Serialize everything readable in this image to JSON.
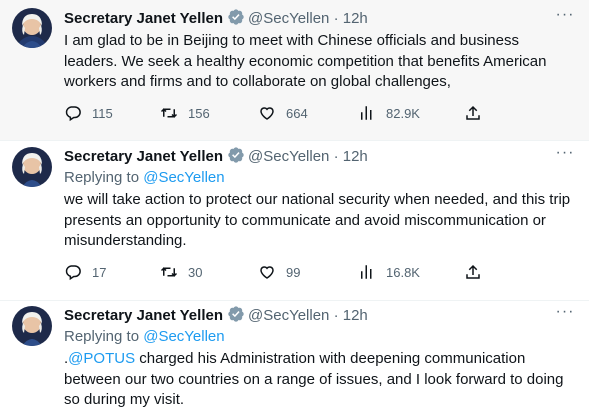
{
  "author": {
    "name": "Secretary Janet Yellen",
    "handle": "@SecYellen",
    "time": "12h",
    "separator": "·",
    "verified_color": "#829aab"
  },
  "colors": {
    "link": "#1d9bf0",
    "muted": "#536471",
    "text": "#0f1419"
  },
  "tweets": [
    {
      "text": "I am glad to be in Beijing to meet with Chinese officials and business leaders. We seek a healthy economic competition that benefits American workers and firms and to collaborate on global challenges,",
      "replies": "115",
      "retweets": "156",
      "likes": "664",
      "views": "82.9K"
    },
    {
      "replying_label": "Replying to",
      "replying_to": "@SecYellen",
      "text": "we will take action to protect our national security when needed, and this trip presents an opportunity to communicate and avoid miscommunication or misunderstanding.",
      "replies": "17",
      "retweets": "30",
      "likes": "99",
      "views": "16.8K"
    },
    {
      "replying_label": "Replying to",
      "replying_to": "@SecYellen",
      "text_prefix": ".",
      "mention": "@POTUS",
      "text": " charged his Administration with deepening communication between our two countries on a range of issues, and I look forward to doing so during my visit."
    }
  ],
  "icons": [
    "verified-badge-icon",
    "more-icon",
    "reply-icon",
    "retweet-icon",
    "like-icon",
    "views-icon",
    "share-icon"
  ]
}
